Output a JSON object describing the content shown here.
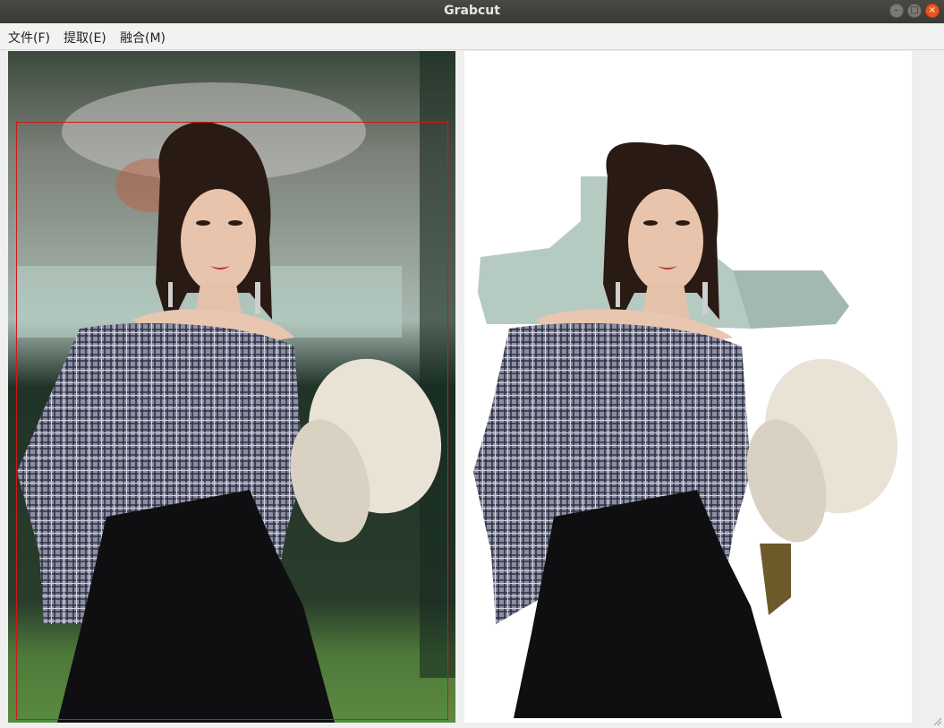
{
  "window": {
    "title": "Grabcut"
  },
  "window_controls": {
    "minimize": "–",
    "maximize": "□",
    "close": "×"
  },
  "menu": [
    {
      "label": "文件(F)"
    },
    {
      "label": "提取(E)"
    },
    {
      "label": "融合(M)"
    }
  ],
  "panels": {
    "source": {
      "image": "portrait-photo"
    },
    "result": {
      "image": "extracted-foreground"
    }
  },
  "colors": {
    "selection_rect": "#d01818",
    "result_background": "#ffffff"
  }
}
